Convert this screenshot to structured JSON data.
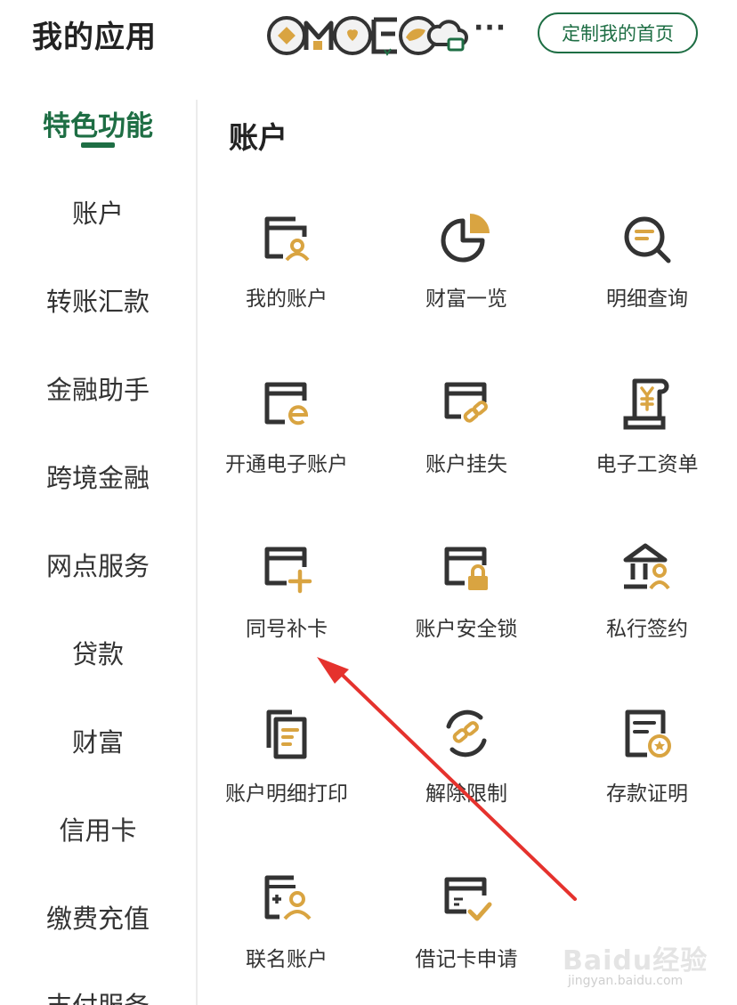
{
  "header": {
    "title": "我的应用",
    "more_label": "···",
    "customize_label": "定制我的首页"
  },
  "sidebar": {
    "items": [
      {
        "label": "特色功能",
        "active": true
      },
      {
        "label": "账户"
      },
      {
        "label": "转账汇款"
      },
      {
        "label": "金融助手"
      },
      {
        "label": "跨境金融"
      },
      {
        "label": "网点服务"
      },
      {
        "label": "贷款"
      },
      {
        "label": "财富"
      },
      {
        "label": "信用卡"
      },
      {
        "label": "缴费充值"
      },
      {
        "label": "支付服务"
      }
    ]
  },
  "content": {
    "section_title": "账户",
    "tiles": [
      {
        "label": "我的账户",
        "icon": "card-user-icon"
      },
      {
        "label": "财富一览",
        "icon": "pie-chart-icon"
      },
      {
        "label": "明细查询",
        "icon": "search-detail-icon"
      },
      {
        "label": "开通电子账户",
        "icon": "card-e-icon"
      },
      {
        "label": "账户挂失",
        "icon": "card-link-icon"
      },
      {
        "label": "电子工资单",
        "icon": "payslip-icon"
      },
      {
        "label": "同号补卡",
        "icon": "card-plus-icon"
      },
      {
        "label": "账户安全锁",
        "icon": "card-lock-icon"
      },
      {
        "label": "私行签约",
        "icon": "bank-user-icon"
      },
      {
        "label": "账户明细打印",
        "icon": "print-docs-icon"
      },
      {
        "label": "解除限制",
        "icon": "unlink-icon"
      },
      {
        "label": "存款证明",
        "icon": "certificate-icon"
      },
      {
        "label": "联名账户",
        "icon": "joint-account-icon"
      },
      {
        "label": "借记卡申请",
        "icon": "card-check-icon"
      }
    ]
  },
  "watermark": {
    "main": "Baidu经验",
    "sub": "jingyan.baidu.com"
  },
  "colors": {
    "brand_green": "#1e6e44",
    "icon_dark": "#333333",
    "icon_gold": "#d9a441",
    "annotation_red": "#e5322d"
  }
}
